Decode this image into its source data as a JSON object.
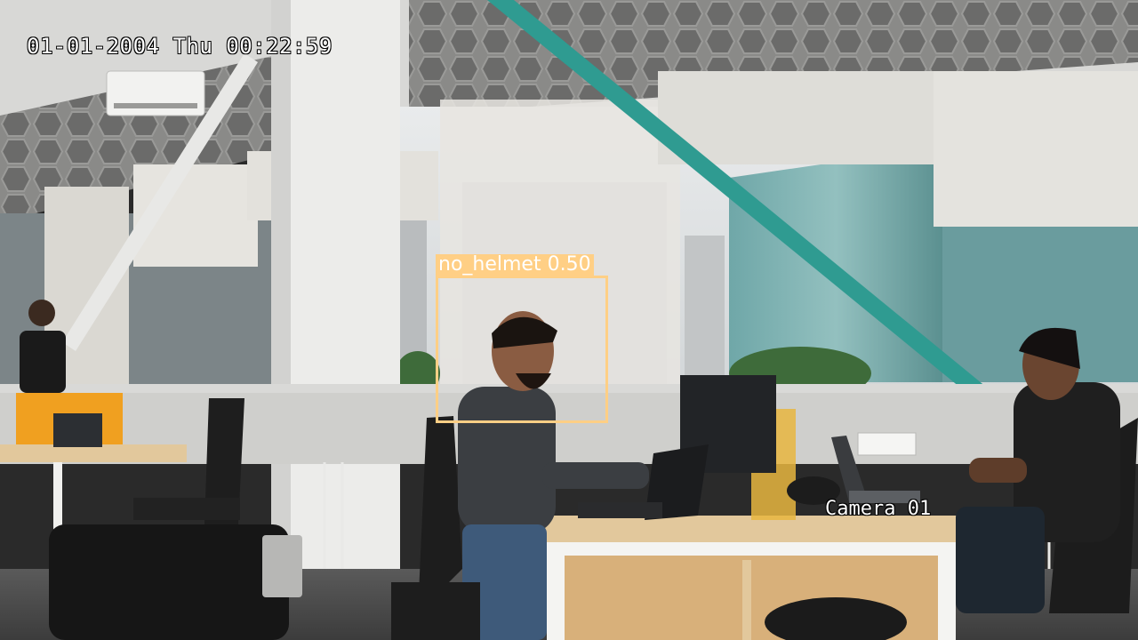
{
  "osd": {
    "timestamp": "01-01-2004 Thu 00:22:59",
    "camera_name": "Camera 01"
  },
  "detections": [
    {
      "class": "no_helmet",
      "score": "0.50",
      "label": "no_helmet 0.50",
      "color": "#ffcf85"
    }
  ],
  "palette": {
    "bbox": "#ffcf85",
    "teal_beam": "#2f9b91",
    "wall_pattern": "#7a7a7a",
    "desk_wood": "#e2c89c",
    "orange_panel": "#f0a020"
  }
}
